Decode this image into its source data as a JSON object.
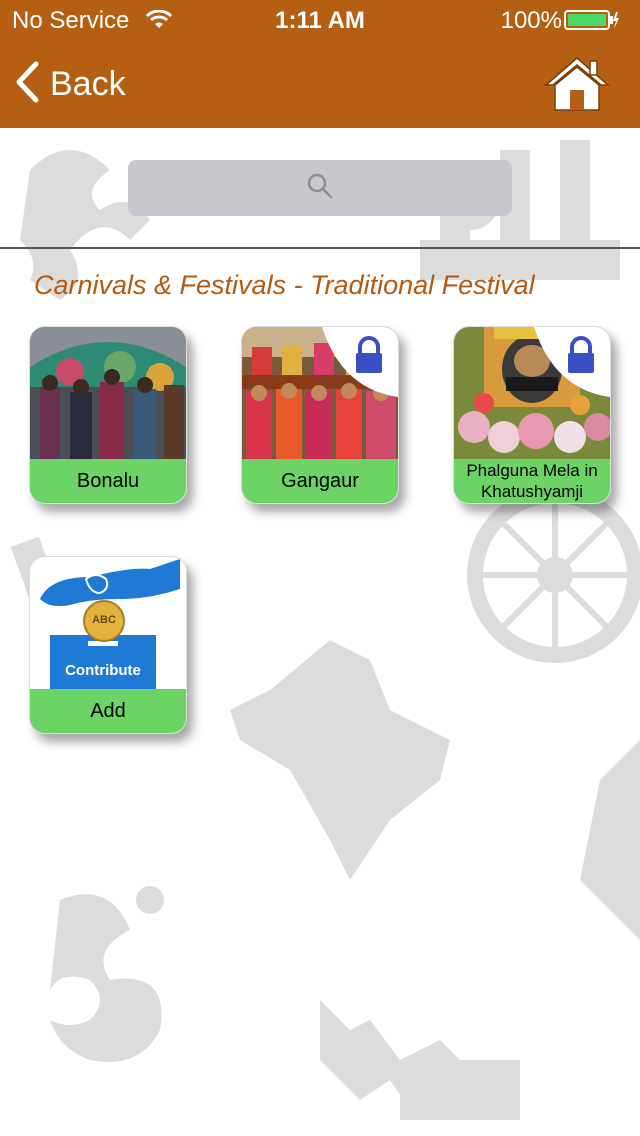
{
  "status_bar": {
    "carrier": "No Service",
    "time": "1:11 AM",
    "battery_percent": "100%"
  },
  "nav": {
    "back_label": "Back",
    "home_icon": "home-icon"
  },
  "search": {
    "icon": "search-icon"
  },
  "section": {
    "title": "Carnivals & Festivals - Traditional Festival"
  },
  "tiles": [
    {
      "label": "Bonalu",
      "locked": false
    },
    {
      "label": "Gangaur",
      "locked": true
    },
    {
      "label": "Phalguna Mela in Khatushyamji",
      "locked": true
    },
    {
      "label": "Add",
      "image_text": "Contribute",
      "coin_text": "ABC",
      "locked": false
    }
  ],
  "colors": {
    "nav_bar": "#b45f12",
    "caption_green": "#6cd466",
    "title_orange": "#b4590f",
    "lock_blue": "#3b4fc4",
    "contribute_blue": "#1f7ad6"
  }
}
